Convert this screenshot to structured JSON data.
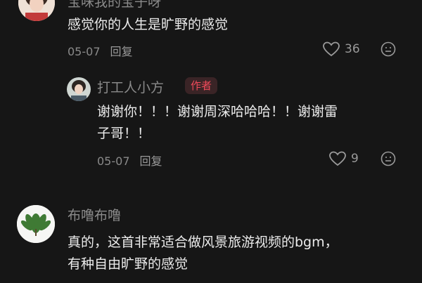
{
  "comments": [
    {
      "user": "宝味我的宝子呀",
      "text": "感觉你的人生是旷野的感觉",
      "date": "05-07",
      "reply_label": "回复",
      "likes": "36"
    },
    {
      "user": "打工人小方",
      "badge": "作者",
      "text_line1": "谢谢你！！！谢谢周深哈哈哈！！谢谢雷",
      "text_line2": "子哥！！",
      "date": "05-07",
      "reply_label": "回复",
      "likes": "9"
    },
    {
      "user": "布噜布噜",
      "text_line1": "真的，这首非常适合做风景旅游视频的bgm，",
      "text_line2": "有种自由旷野的感觉"
    }
  ],
  "icons": {
    "like": "heart-icon",
    "more": "comment-emoji-icon"
  },
  "colors": {
    "background": "#161616",
    "author_badge_bg": "#3a2426",
    "author_badge_text": "#f04a5a"
  }
}
